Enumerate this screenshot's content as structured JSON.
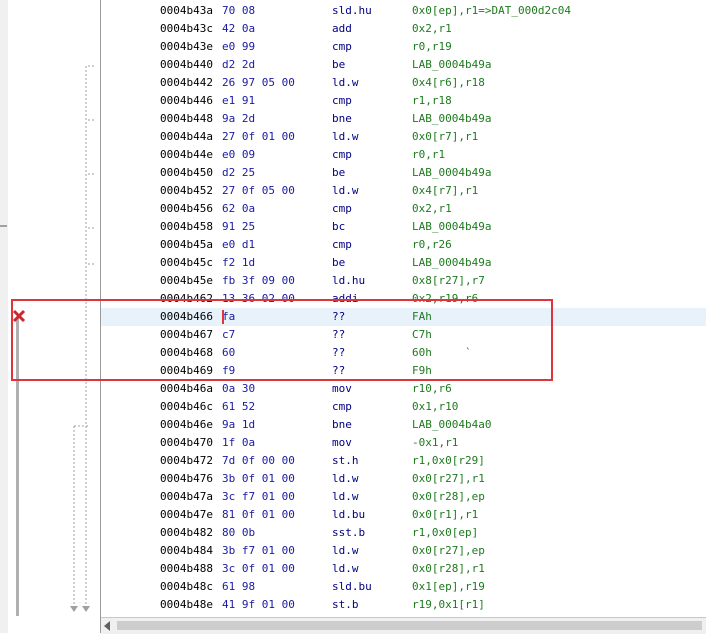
{
  "rows": [
    {
      "addr": "0004b43a",
      "bytes": "70 08",
      "mnem": "sld.hu",
      "ops": "0x0[ep],r1=>DAT_000d2c04"
    },
    {
      "addr": "0004b43c",
      "bytes": "42 0a",
      "mnem": "add",
      "ops": "0x2,r1"
    },
    {
      "addr": "0004b43e",
      "bytes": "e0 99",
      "mnem": "cmp",
      "ops": "r0,r19"
    },
    {
      "addr": "0004b440",
      "bytes": "d2 2d",
      "mnem": "be",
      "ops": "LAB_0004b49a"
    },
    {
      "addr": "0004b442",
      "bytes": "26 97 05 00",
      "mnem": "ld.w",
      "ops": "0x4[r6],r18"
    },
    {
      "addr": "0004b446",
      "bytes": "e1 91",
      "mnem": "cmp",
      "ops": "r1,r18"
    },
    {
      "addr": "0004b448",
      "bytes": "9a 2d",
      "mnem": "bne",
      "ops": "LAB_0004b49a"
    },
    {
      "addr": "0004b44a",
      "bytes": "27 0f 01 00",
      "mnem": "ld.w",
      "ops": "0x0[r7],r1"
    },
    {
      "addr": "0004b44e",
      "bytes": "e0 09",
      "mnem": "cmp",
      "ops": "r0,r1"
    },
    {
      "addr": "0004b450",
      "bytes": "d2 25",
      "mnem": "be",
      "ops": "LAB_0004b49a"
    },
    {
      "addr": "0004b452",
      "bytes": "27 0f 05 00",
      "mnem": "ld.w",
      "ops": "0x4[r7],r1"
    },
    {
      "addr": "0004b456",
      "bytes": "62 0a",
      "mnem": "cmp",
      "ops": "0x2,r1"
    },
    {
      "addr": "0004b458",
      "bytes": "91 25",
      "mnem": "bc",
      "ops": "LAB_0004b49a"
    },
    {
      "addr": "0004b45a",
      "bytes": "e0 d1",
      "mnem": "cmp",
      "ops": "r0,r26"
    },
    {
      "addr": "0004b45c",
      "bytes": "f2 1d",
      "mnem": "be",
      "ops": "LAB_0004b49a"
    },
    {
      "addr": "0004b45e",
      "bytes": "fb 3f 09 00",
      "mnem": "ld.hu",
      "ops": "0x8[r27],r7"
    },
    {
      "addr": "0004b462",
      "bytes": "13 36 02 00",
      "mnem": "addi",
      "ops": "0x2,r19,r6"
    },
    {
      "addr": "0004b466",
      "bytes": "fa",
      "mnem": "??",
      "ops": "FAh"
    },
    {
      "addr": "0004b467",
      "bytes": "c7",
      "mnem": "??",
      "ops": "C7h"
    },
    {
      "addr": "0004b468",
      "bytes": "60",
      "mnem": "??",
      "ops": "60h     `"
    },
    {
      "addr": "0004b469",
      "bytes": "f9",
      "mnem": "??",
      "ops": "F9h"
    },
    {
      "addr": "0004b46a",
      "bytes": "0a 30",
      "mnem": "mov",
      "ops": "r10,r6"
    },
    {
      "addr": "0004b46c",
      "bytes": "61 52",
      "mnem": "cmp",
      "ops": "0x1,r10"
    },
    {
      "addr": "0004b46e",
      "bytes": "9a 1d",
      "mnem": "bne",
      "ops": "LAB_0004b4a0"
    },
    {
      "addr": "0004b470",
      "bytes": "1f 0a",
      "mnem": "mov",
      "ops": "-0x1,r1"
    },
    {
      "addr": "0004b472",
      "bytes": "7d 0f 00 00",
      "mnem": "st.h",
      "ops": "r1,0x0[r29]"
    },
    {
      "addr": "0004b476",
      "bytes": "3b 0f 01 00",
      "mnem": "ld.w",
      "ops": "0x0[r27],r1"
    },
    {
      "addr": "0004b47a",
      "bytes": "3c f7 01 00",
      "mnem": "ld.w",
      "ops": "0x0[r28],ep"
    },
    {
      "addr": "0004b47e",
      "bytes": "81 0f 01 00",
      "mnem": "ld.bu",
      "ops": "0x0[r1],r1"
    },
    {
      "addr": "0004b482",
      "bytes": "80 0b",
      "mnem": "sst.b",
      "ops": "r1,0x0[ep]"
    },
    {
      "addr": "0004b484",
      "bytes": "3b f7 01 00",
      "mnem": "ld.w",
      "ops": "0x0[r27],ep"
    },
    {
      "addr": "0004b488",
      "bytes": "3c 0f 01 00",
      "mnem": "ld.w",
      "ops": "0x0[r28],r1"
    },
    {
      "addr": "0004b48c",
      "bytes": "61 98",
      "mnem": "sld.bu",
      "ops": "0x1[ep],r19"
    },
    {
      "addr": "0004b48e",
      "bytes": "41 9f 01 00",
      "mnem": "st.b",
      "ops": "r19,0x1[r1]"
    }
  ],
  "highlighted_row": 17,
  "colors": {
    "selection_border": "#e0343b",
    "highlight_bg": "#e8f2fb",
    "error_marker": "#d0252b"
  },
  "icons": {
    "error_marker": "error-x-icon",
    "scroll_left": "scroll-left-arrow-icon"
  }
}
